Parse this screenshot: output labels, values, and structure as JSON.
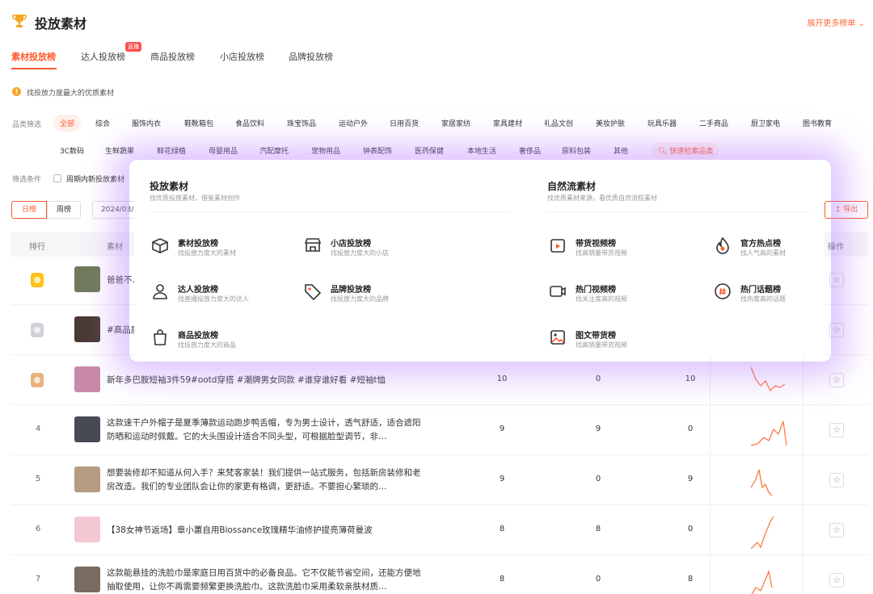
{
  "header": {
    "title": "投放素材",
    "expand_more": "展开更多榜单 ⌄",
    "tabs": [
      {
        "label": "素材投放榜",
        "active": true
      },
      {
        "label": "达人投放榜",
        "badge": "直播"
      },
      {
        "label": "商品投放榜"
      },
      {
        "label": "小店投放榜"
      },
      {
        "label": "品牌投放榜"
      }
    ]
  },
  "hint": "找投放力度最大的优质素材",
  "category": {
    "label": "品类筛选",
    "row1": [
      "全部",
      "综合",
      "服饰内衣",
      "鞋靴箱包",
      "食品饮料",
      "珠宝饰品",
      "运动户外",
      "日用百货",
      "家居家纺",
      "家具建材",
      "礼品文创",
      "美妆护肤",
      "玩具乐器",
      "二手商品",
      "厨卫家电",
      "图书教育"
    ],
    "row2": [
      "3C数码",
      "生鲜蔬果",
      "鲜花绿植",
      "母婴用品",
      "汽配摩托",
      "宠物用品",
      "钟表配饰",
      "医药保健",
      "本地生活",
      "奢侈品",
      "原料包装",
      "其他"
    ],
    "quick_search": "快速检索品类"
  },
  "condition": {
    "label": "筛选条件",
    "checkbox_label": "周期内新投放素材"
  },
  "toolbar": {
    "day": "日榜",
    "week": "周榜",
    "date": "2024/03/",
    "export": "导出"
  },
  "table": {
    "headers": {
      "rank": "排行",
      "material": "素材",
      "action": "操作"
    },
    "rows": [
      {
        "rank": "1",
        "title": "爸爸不…罗新款…",
        "a": "",
        "b": "",
        "c": ""
      },
      {
        "rank": "2",
        "title": "#高品质…",
        "a": "",
        "b": "",
        "c": ""
      },
      {
        "rank": "3",
        "title": "新年多巴胺短袖3件59#ootd穿搭 #潮牌男女同款 #谁穿谁好看 #短袖t恤",
        "a": "10",
        "b": "0",
        "c": "10"
      },
      {
        "rank": "4",
        "title": "这款速干户外帽子是夏季薄款运动跑步鸭舌帽，专为男士设计，透气舒适，适合遮阳防晒和运动时佩戴。它的大头围设计适合不同头型，可根据脸型调节，非…",
        "a": "9",
        "b": "9",
        "c": "0"
      },
      {
        "rank": "5",
        "title": "想要装修却不知道从何入手？来梵客家装！我们提供一站式服务，包括新房装修和老房改造。我们的专业团队会让你的家更有格调，更舒适。不要担心繁琐的…",
        "a": "9",
        "b": "0",
        "c": "9"
      },
      {
        "rank": "6",
        "title": "【38女神节返场】章小蕙自用Biossance玫瑰精华油修护提亮薄荷曼波",
        "a": "8",
        "b": "8",
        "c": "0"
      },
      {
        "rank": "7",
        "title": "这款能悬挂的洗脸巾是家庭日用百货中的必备良品。它不仅能节省空间，还能方便地抽取使用，让你不再需要频繁更换洗脸巾。这款洗脸巾采用柔软亲肤材质…",
        "a": "8",
        "b": "0",
        "c": "8"
      }
    ]
  },
  "popup": {
    "left": {
      "title": "投放素材",
      "subtitle": "找优质投放素材，借鉴素材创作",
      "items": [
        {
          "label": "素材投放榜",
          "desc": "找投放力度大的素材",
          "icon": "box-icon"
        },
        {
          "label": "小店投放榜",
          "desc": "找投放力度大的小店",
          "icon": "shop-icon"
        },
        {
          "label": "达人投放榜",
          "desc": "找直播投放力度大的达人",
          "icon": "user-icon"
        },
        {
          "label": "品牌投放榜",
          "desc": "找投放力度大的品牌",
          "icon": "tag-icon"
        },
        {
          "label": "商品投放榜",
          "desc": "找投放力度大的商品",
          "icon": "bag-icon"
        }
      ]
    },
    "right": {
      "title": "自然流素材",
      "subtitle": "找优质素材来源，看优质自然流程素材",
      "items": [
        {
          "label": "带货视频榜",
          "desc": "找高销量带货视频",
          "icon": "video-cart-icon"
        },
        {
          "label": "官方热点榜",
          "desc": "找人气高的素材",
          "icon": "flame-icon"
        },
        {
          "label": "热门视频榜",
          "desc": "找关注度高的视频",
          "icon": "camera-icon"
        },
        {
          "label": "热门话题榜",
          "desc": "找热度高的话题",
          "icon": "hashtag-icon"
        },
        {
          "label": "图文带货榜",
          "desc": "找高销量带货视频",
          "icon": "image-icon"
        }
      ]
    }
  },
  "colors": {
    "accent": "#ff5a2c",
    "glow": "#b478ff"
  }
}
